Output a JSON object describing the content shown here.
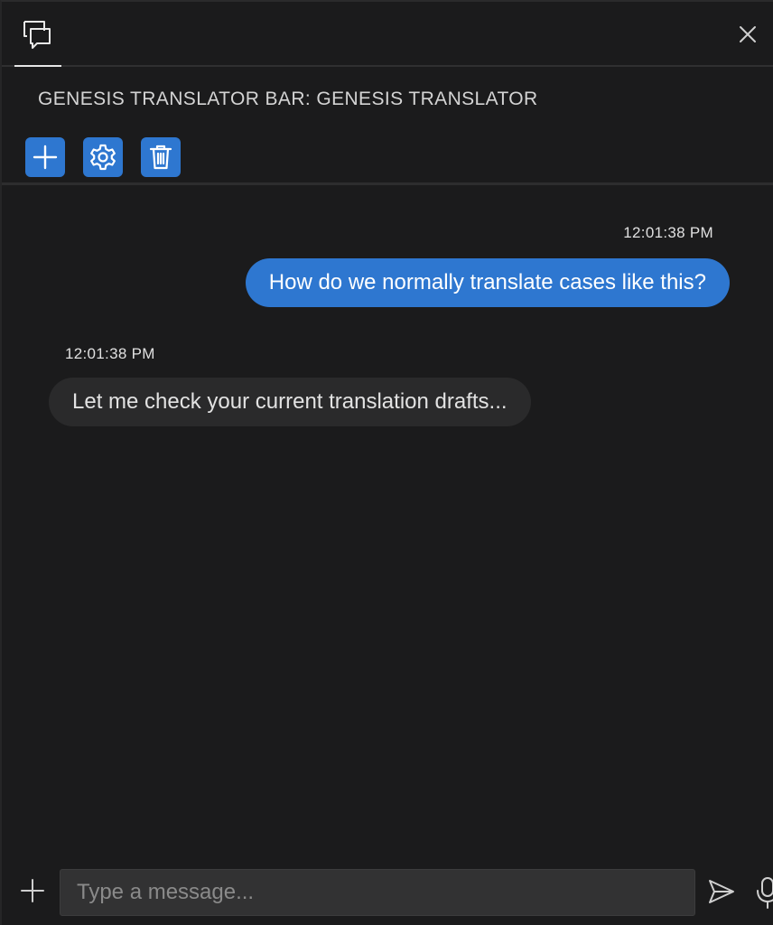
{
  "header": {
    "tab_icon": "chat-bubbles-icon",
    "close_icon": "close-icon",
    "title": "GENESIS TRANSLATOR BAR: GENESIS TRANSLATOR"
  },
  "toolbar": {
    "buttons": [
      {
        "icon": "plus-icon",
        "label": "New"
      },
      {
        "icon": "gear-icon",
        "label": "Settings"
      },
      {
        "icon": "trash-icon",
        "label": "Delete"
      }
    ]
  },
  "messages": [
    {
      "role": "user",
      "time": "12:01:38 PM",
      "text": "How do we normally translate cases like this?"
    },
    {
      "role": "assistant",
      "time": "12:01:38 PM",
      "text": "Let me check your current translation drafts..."
    }
  ],
  "composer": {
    "value": "",
    "placeholder": "Type a message...",
    "attach_icon": "plus-icon",
    "send_icon": "send-icon",
    "mic_icon": "microphone-icon"
  },
  "colors": {
    "background": "#1b1b1c",
    "accent": "#2e77d0",
    "bot_bubble": "#2a2a2b",
    "input_background": "#323233"
  }
}
